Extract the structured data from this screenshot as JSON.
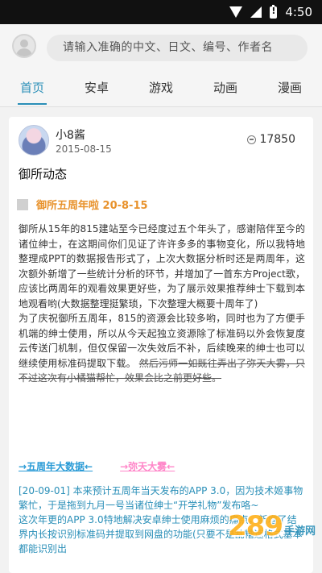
{
  "status_bar": {
    "time": "4:50"
  },
  "search": {
    "placeholder": "请输入准确的中文、日文、编号、作者名"
  },
  "tabs": [
    {
      "label": "首页",
      "active": true
    },
    {
      "label": "安卓",
      "active": false
    },
    {
      "label": "游戏",
      "active": false
    },
    {
      "label": "动画",
      "active": false
    },
    {
      "label": "漫画",
      "active": false
    }
  ],
  "post": {
    "author": "小8酱",
    "date": "2015-08-15",
    "views": "17850",
    "title": "御所动态",
    "subheading": "御所五周年啦 20-8-15",
    "body": "御所从15年的815建站至今已经度过五个年头了，感谢陪伴至今的诸位绅士，在这期间你们见证了许许多多的事物变化，所以我特地整理成PPT的数据报告形式了，上次大数据分析时还是两周年，这次额外新增了一些统计分析的环节，并增加了一首东方Project歌，应该比两周年的观看效果更好些，为了展示效果推荐绅士下载到本地观看哟(大数据整理挺繁琐，下次整理大概要十周年了)\n为了庆祝御所五周年，815的资源会比较多哟，同时也为了方便手机端的绅士使用，所以从今天起独立资源除了标准码以外会恢复度云传送门机制，但仅保留一次失效后不补，后续晚来的绅士也可以继续使用标准码提取下载。",
    "body_strike": "然后污师一如既往弄出了弥天大雾，只不过这次有小橘猫帮忙，效果会比之前更好些。",
    "link_1": "→五周年大数据←",
    "link_2": "→弥天大雾←",
    "update": "[20-09-01] 本来预计五周年当天发布的APP 3.0，因为技术姬事物繁忙，于是拖到九月一号当诸位绅士“开学礼物”发布咯~\n这次年更的APP 3.0特地解决安卓绅士使用麻烦的痛点，新增了结界内长按识别标准码并提取到网盘的功能(只要不是乱糟速格式基本都能识别出"
  },
  "watermark": {
    "logo": "289",
    "text": "手游网"
  }
}
